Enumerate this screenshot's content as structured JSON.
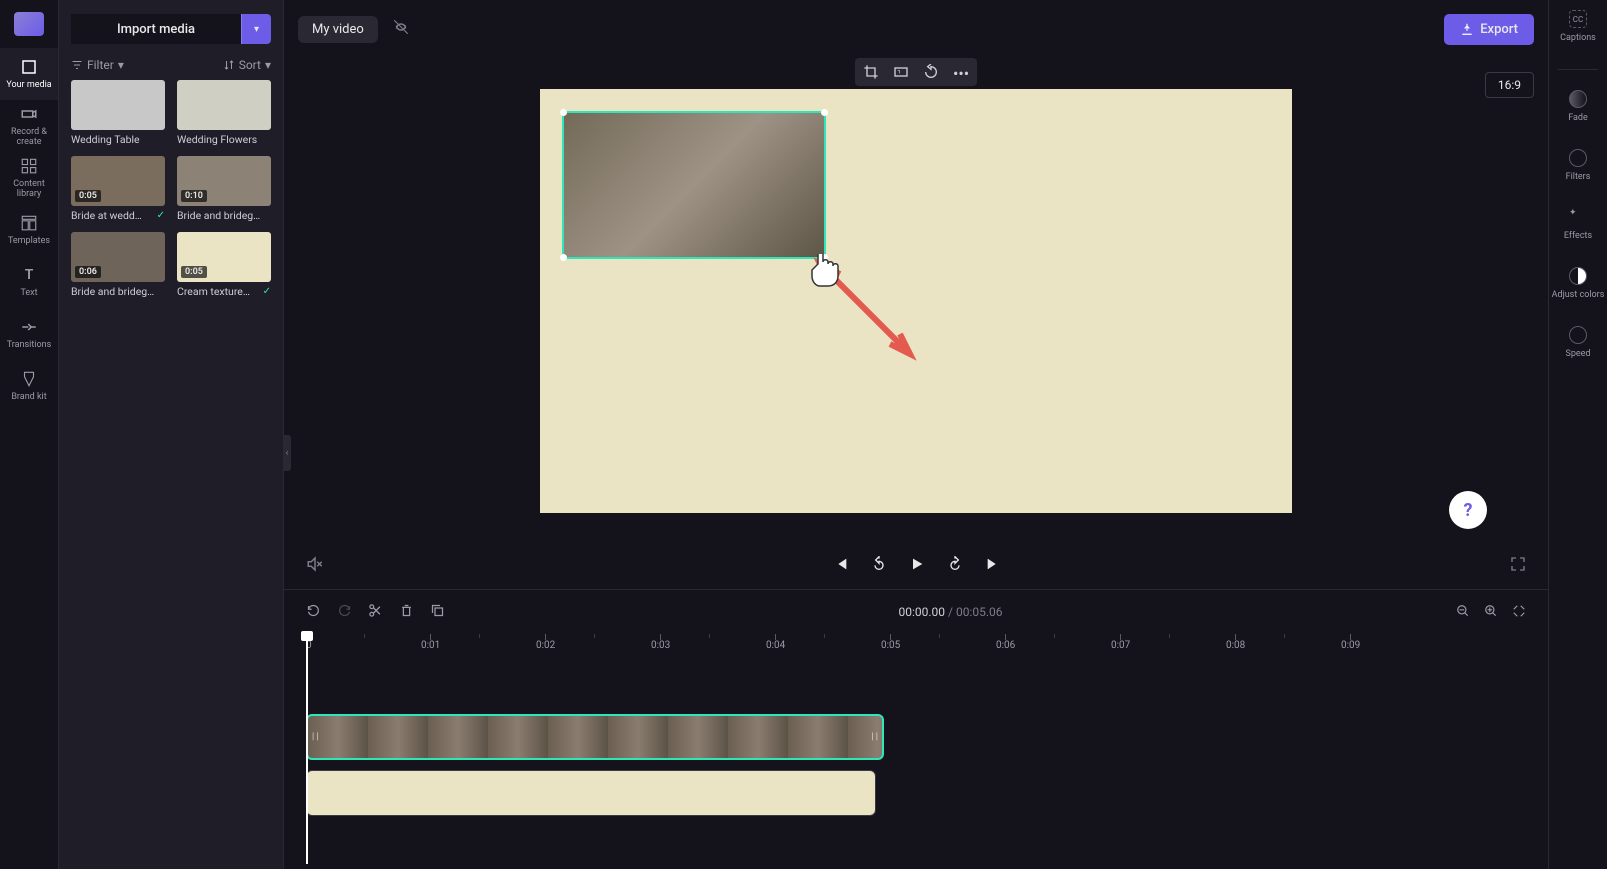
{
  "app": {
    "title": "My video"
  },
  "import_button": {
    "label": "Import media"
  },
  "filter_label": "Filter",
  "sort_label": "Sort",
  "left_nav": {
    "items": [
      {
        "label": "Your media",
        "icon": "media"
      },
      {
        "label": "Record & create",
        "icon": "camera"
      },
      {
        "label": "Content library",
        "icon": "grid"
      },
      {
        "label": "Templates",
        "icon": "template"
      },
      {
        "label": "Text",
        "icon": "text"
      },
      {
        "label": "Transitions",
        "icon": "transitions"
      },
      {
        "label": "Brand kit",
        "icon": "brand"
      }
    ]
  },
  "media_items": [
    {
      "label": "Wedding Table",
      "duration": "",
      "tone": "#c8c8c8"
    },
    {
      "label": "Wedding Flowers",
      "duration": "",
      "tone": "#d0cfc4"
    },
    {
      "label": "Bride at wedd…",
      "duration": "0:05",
      "tone": "#7a6d5e",
      "used": true
    },
    {
      "label": "Bride and brideg…",
      "duration": "0:10",
      "tone": "#8c8276"
    },
    {
      "label": "Bride and brideg…",
      "duration": "0:06",
      "tone": "#6e6459"
    },
    {
      "label": "Cream texture…",
      "duration": "0:05",
      "tone": "#ebe4c4",
      "used": true
    }
  ],
  "export": {
    "label": "Export"
  },
  "aspect": "16:9",
  "crop_toolbar": [
    "crop-icon",
    "aspect-icon",
    "rotate-icon",
    "more-icon"
  ],
  "controls": {
    "prev": "prev",
    "back10": "-10",
    "play": "play",
    "fwd10": "+10",
    "next": "next"
  },
  "time": {
    "current": "00:00.00",
    "sep": " / ",
    "total": "00:05.06"
  },
  "ruler": [
    "0",
    "0:01",
    "0:02",
    "0:03",
    "0:04",
    "0:05",
    "0:06",
    "0:07",
    "0:08",
    "0:09"
  ],
  "right_nav": {
    "items": [
      {
        "label": "Captions"
      },
      {
        "label": "Fade"
      },
      {
        "label": "Filters"
      },
      {
        "label": "Effects"
      },
      {
        "label": "Adjust colors"
      },
      {
        "label": "Speed"
      }
    ]
  },
  "help": "?"
}
